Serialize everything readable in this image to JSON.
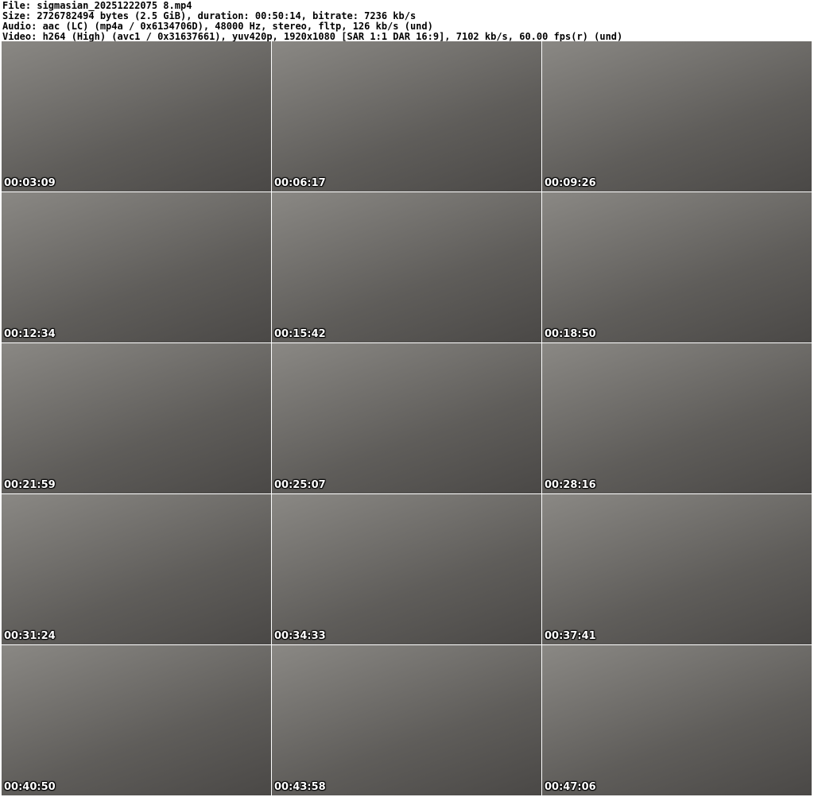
{
  "header": {
    "file": "File: sigmasian_20251222075 8.mp4",
    "size": "Size: 2726782494 bytes (2.5 GiB), duration: 00:50:14, bitrate: 7236 kb/s",
    "audio": "Audio: aac (LC) (mp4a / 0x6134706D), 48000 Hz, stereo, fltp, 126 kb/s (und)",
    "video": "Video: h264 (High) (avc1 / 0x31637661), yuv420p, 1920x1080 [SAR 1:1 DAR 16:9], 7102 kb/s, 60.00 fps(r) (und)"
  },
  "frames": [
    {
      "timestamp": "00:03:09"
    },
    {
      "timestamp": "00:06:17"
    },
    {
      "timestamp": "00:09:26"
    },
    {
      "timestamp": "00:12:34"
    },
    {
      "timestamp": "00:15:42"
    },
    {
      "timestamp": "00:18:50"
    },
    {
      "timestamp": "00:21:59"
    },
    {
      "timestamp": "00:25:07"
    },
    {
      "timestamp": "00:28:16"
    },
    {
      "timestamp": "00:31:24"
    },
    {
      "timestamp": "00:34:33"
    },
    {
      "timestamp": "00:37:41"
    },
    {
      "timestamp": "00:40:50"
    },
    {
      "timestamp": "00:43:58"
    },
    {
      "timestamp": "00:47:06"
    }
  ]
}
